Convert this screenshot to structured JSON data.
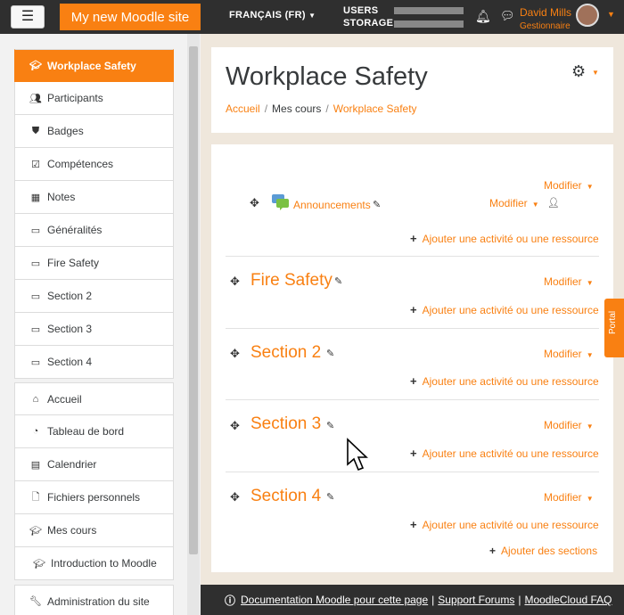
{
  "navbar": {
    "site_name": "My new Moodle site",
    "language": "FRANÇAIS (FR)",
    "usage_users": "USERS",
    "usage_storage": "STORAGE",
    "user_name": "David Mills",
    "user_role": "Gestionnaire"
  },
  "drawer": {
    "course_items": [
      {
        "label": "Workplace Safety",
        "icon": "graduation-cap-icon"
      },
      {
        "label": "Participants",
        "icon": "users-icon"
      },
      {
        "label": "Badges",
        "icon": "shield-icon"
      },
      {
        "label": "Compétences",
        "icon": "check-square-icon"
      },
      {
        "label": "Notes",
        "icon": "table-icon"
      },
      {
        "label": "Généralités",
        "icon": "folder-icon"
      },
      {
        "label": "Fire Safety",
        "icon": "folder-icon"
      },
      {
        "label": "Section 2",
        "icon": "folder-icon"
      },
      {
        "label": "Section 3",
        "icon": "folder-icon"
      },
      {
        "label": "Section 4",
        "icon": "folder-icon"
      }
    ],
    "site_items": [
      {
        "label": "Accueil",
        "icon": "home-icon"
      },
      {
        "label": "Tableau de bord",
        "icon": "dashboard-icon"
      },
      {
        "label": "Calendrier",
        "icon": "calendar-icon"
      },
      {
        "label": "Fichiers personnels",
        "icon": "file-icon"
      },
      {
        "label": "Mes cours",
        "icon": "graduation-cap-icon"
      },
      {
        "label": "Introduction to Moodle",
        "icon": "graduation-cap-icon"
      }
    ],
    "admin_item": {
      "label": "Administration du site",
      "icon": "wrench-icon"
    }
  },
  "header": {
    "title": "Workplace Safety",
    "breadcrumb": [
      "Accueil",
      "Mes cours",
      "Workplace Safety"
    ]
  },
  "course": {
    "modifier": "Modifier",
    "add_activity": "Ajouter une activité ou une ressource",
    "announcements": "Announcements",
    "sections": [
      "Fire Safety",
      "Section 2",
      "Section 3",
      "Section 4"
    ],
    "add_sections": "Ajouter des sections"
  },
  "portal_tab": "Portal",
  "footer": {
    "doc_link": "Documentation Moodle pour cette page",
    "sep": "|",
    "support": "Support Forums",
    "faq": "MoodleCloud FAQ"
  },
  "colors": {
    "accent": "#f98012",
    "navbar": "#2f2f2f"
  }
}
